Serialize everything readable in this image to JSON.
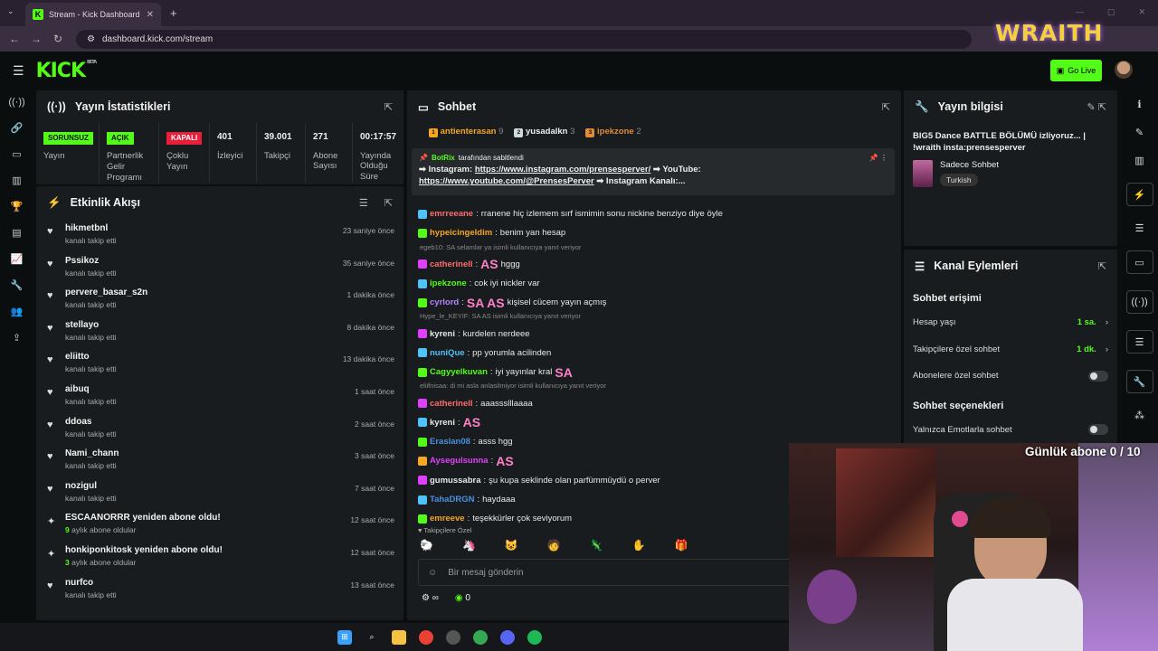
{
  "browser": {
    "tab_title": "Stream - Kick Dashboard",
    "url": "dashboard.kick.com/stream",
    "overlay_text": "WRAITH"
  },
  "header": {
    "logo": "KICK",
    "beta": "BETA",
    "go_live": "Go Live"
  },
  "stats": {
    "title": "Yayın İstatistikleri",
    "cells": [
      {
        "badge": "SORUNSUZ",
        "badge_color": "#53fc18",
        "label": "Yayın"
      },
      {
        "badge": "AÇIK",
        "badge_color": "#53fc18",
        "label": "Partnerlik Gelir Programı"
      },
      {
        "badge": "KAPALI",
        "badge_color": "#e91e3a",
        "label": "Çoklu Yayın"
      },
      {
        "value": "401",
        "label": "İzleyici"
      },
      {
        "value": "39.001",
        "label": "Takipçi"
      },
      {
        "value": "271",
        "label": "Abone Sayısı"
      },
      {
        "value": "00:17:57",
        "label": "Yayında Olduğu Süre"
      }
    ]
  },
  "activity": {
    "title": "Etkinlik Akışı",
    "items": [
      {
        "icon": "heart",
        "name": "hikmetbnl",
        "sub": "kanalı takip etti",
        "time": "23 saniye önce"
      },
      {
        "icon": "heart",
        "name": "Pssikoz",
        "sub": "kanalı takip etti",
        "time": "35 saniye önce"
      },
      {
        "icon": "heart",
        "name": "pervere_basar_s2n",
        "sub": "kanalı takip etti",
        "time": "1 dakika önce"
      },
      {
        "icon": "heart",
        "name": "stellayo",
        "sub": "kanalı takip etti",
        "time": "8 dakika önce"
      },
      {
        "icon": "heart",
        "name": "eliitto",
        "sub": "kanalı takip etti",
        "time": "13 dakika önce"
      },
      {
        "icon": "heart",
        "name": "aibuq",
        "sub": "kanalı takip etti",
        "time": "1 saat önce"
      },
      {
        "icon": "heart",
        "name": "ddoas",
        "sub": "kanalı takip etti",
        "time": "2 saat önce"
      },
      {
        "icon": "heart",
        "name": "Nami_chann",
        "sub": "kanalı takip etti",
        "time": "3 saat önce"
      },
      {
        "icon": "heart",
        "name": "nozigul",
        "sub": "kanalı takip etti",
        "time": "7 saat önce"
      },
      {
        "icon": "star",
        "name": "ESCAANORRR yeniden abone oldu!",
        "count": "9",
        "sub": "aylık abone oldular",
        "time": "12 saat önce"
      },
      {
        "icon": "star",
        "name": "honkiponkitosk yeniden abone oldu!",
        "count": "3",
        "sub": "aylık abone oldular",
        "time": "12 saat önce"
      },
      {
        "icon": "heart",
        "name": "nurfco",
        "sub": "kanalı takip etti",
        "time": "13 saat önce"
      }
    ]
  },
  "chat": {
    "title": "Sohbet",
    "top_gifters": [
      {
        "name": "antienterasan",
        "count": "9"
      },
      {
        "name": "yusadalkn",
        "count": "3"
      },
      {
        "name": "ipekzone",
        "count": "2"
      }
    ],
    "pinned": {
      "by": "BotRix",
      "by_suffix": "tarafından sabitlendi",
      "line1_pre": "➡ Instagram: ",
      "link1": "https://www.instagram.com/prensesperver/",
      "line1_post": " ➡ YouTube:",
      "link2": "https://www.youtube.com/@PrensesPerver",
      "line2_post": " ➡ Instagram Kanalı:..."
    },
    "messages": [
      {
        "user": "emrreeane",
        "color": "#ff6b6b",
        "text": "rranene hiç izlemem sırf ismimin sonu nickine benziyo diye öyle"
      },
      {
        "user": "hypeicingeldim",
        "color": "#f5a623",
        "text": "benim yan hesap"
      },
      {
        "reply": "egeb10: SA selamlar ya isimli kullanıcıya yanıt veriyor"
      },
      {
        "user": "catherinell",
        "color": "#ff6b6b",
        "emote_pre": "AS",
        "text": "hggg"
      },
      {
        "user": "ipekzone",
        "color": "#53fc18",
        "text": "cok iyi nickler var"
      },
      {
        "user": "cyrlord",
        "color": "#b388ff",
        "emote_pre": "SA AS",
        "text": "kişisel cücem yayın açmış"
      },
      {
        "reply": "Hype_le_KEYIF: SA AS isimli kullanıcıya yanıt veriyor"
      },
      {
        "user": "kyreni",
        "color": "#e8e8e8",
        "text": "kurdelen nerdeee"
      },
      {
        "user": "nuniQue",
        "color": "#4fc3f7",
        "text": "pp yorumla acilinden"
      },
      {
        "user": "Cagyyelkuvan",
        "color": "#53fc18",
        "text": "iyi yayınlar kral",
        "emote_post": "SA"
      },
      {
        "reply": "eliifnisaa: di mi asla anlasilmiyor isimli kullanıcıya yanıt veriyor"
      },
      {
        "user": "catherinell",
        "color": "#ff6b6b",
        "text": "aaassslllaaaa"
      },
      {
        "user": "kyreni",
        "color": "#e8e8e8",
        "emote_post": "AS",
        "text": ""
      },
      {
        "user": "Eraslan08",
        "color": "#4a90e2",
        "text": "asss hgg"
      },
      {
        "user": "Aysegulsunna",
        "color": "#e040fb",
        "emote_post": "AS",
        "text": ""
      },
      {
        "user": "gumussabra",
        "color": "#e8e8e8",
        "text": "şu kupa seklinde olan parfümmüydü o perver"
      },
      {
        "user": "TahaDRGN",
        "color": "#4a90e2",
        "text": "haydaaa"
      },
      {
        "user": "emreeve",
        "color": "#f5a623",
        "text": "teşekkürler çok seviyorum"
      }
    ],
    "followers_only": "Takipçilere Özel",
    "input_placeholder": "Bir mesaj gönderin",
    "points": "0"
  },
  "info": {
    "title": "Yayın bilgisi",
    "stream_title": "BIG5 Dance BATTLE BÖLÜMÜ izliyoruz... | !wraith insta:prensesperver",
    "category": "Sadece Sohbet",
    "language": "Turkish"
  },
  "kanal": {
    "title": "Kanal Eylemleri",
    "sec1": "Sohbet erişimi",
    "rows": [
      {
        "label": "Hesap yaşı",
        "value": "1 sa."
      },
      {
        "label": "Takipçilere özel sohbet",
        "value": "1 dk."
      },
      {
        "label": "Abonelere özel sohbet",
        "toggle": "off"
      }
    ],
    "sec2": "Sohbet seçenekleri",
    "row2": "Yalnızca Emotlarla sohbet"
  },
  "overlay": {
    "daily_sub": "Günlük abone 0 / 10"
  }
}
